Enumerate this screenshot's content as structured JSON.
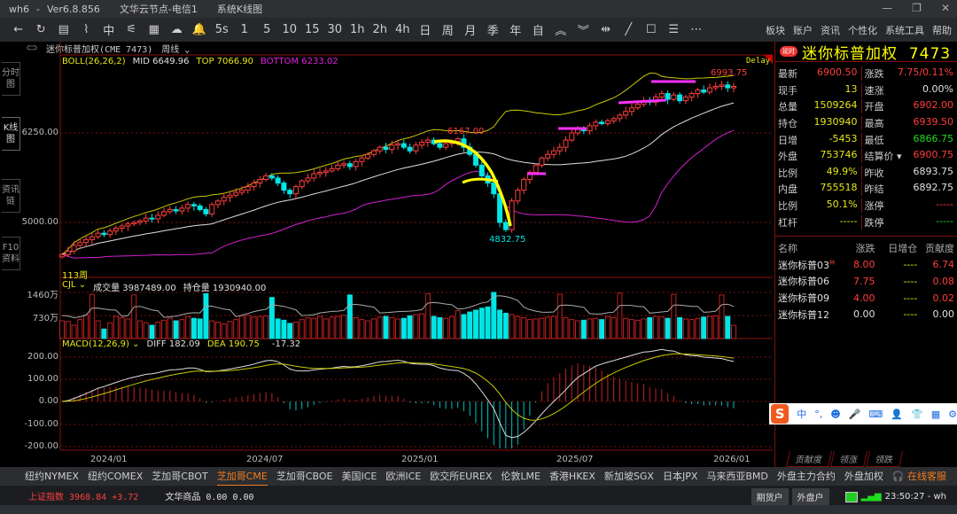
{
  "window": {
    "title_parts": [
      "wh6",
      "-",
      "Ver6.8.856",
      "文华云节点-电信1",
      "系统K线图"
    ],
    "controls": [
      "—",
      "❐",
      "✕"
    ]
  },
  "toolbar": {
    "icons": [
      "←",
      "↻",
      "▤",
      "⌇",
      "中",
      "⚟",
      "▦",
      "☁",
      "🔔"
    ],
    "periods": [
      "5s",
      "1",
      "5",
      "10",
      "15",
      "30",
      "1h",
      "2h",
      "4h",
      "日",
      "周",
      "月",
      "季",
      "年",
      "自"
    ],
    "tools": [
      "︽",
      "︾",
      "⇹",
      "╱",
      "☐",
      "☰",
      "⋯"
    ],
    "menu": [
      "板块",
      "账户",
      "资讯",
      "个性化",
      "系统工具",
      "帮助"
    ]
  },
  "subheader": {
    "symbol": "迷你标普加权(CME 7473)",
    "period": "周线"
  },
  "left_tabs": [
    "分时图",
    "K线图",
    "资讯链",
    "F10资料"
  ],
  "main_indicator": {
    "name": "BOLL(26,26,2)",
    "mid": "MID 6649.96",
    "top": "TOP 7066.90",
    "bottom": "BOTTOM 6233.02",
    "delay": "Delay"
  },
  "volume_indicator": {
    "name": "CJL",
    "vol": "成交量 3987489.00",
    "oi": "持仓量 1930940.00"
  },
  "macd_indicator": {
    "name": "MACD(12,26,9)",
    "diff": "DIFF 182.09",
    "dea": "DEA 190.75",
    "macd": "-17.32"
  },
  "colors": {
    "up": "#ff3d3d",
    "down": "#00e5e5",
    "boll_top": "#c8c800",
    "boll_mid": "#e0e0e0",
    "boll_bot": "#d020d0",
    "grid": "#7a1010",
    "annot_yellow": "#ffff00",
    "annot_magenta": "#ff30ff"
  },
  "chart_data": {
    "type": "candlestick",
    "period": "weekly",
    "price_ticks": [
      "6250.00",
      "5000.00"
    ],
    "price_tick_values": [
      6250,
      5000
    ],
    "volume_ticks": [
      "1460万",
      "730万"
    ],
    "macd_ticks": [
      "200.00",
      "100.00",
      "0.00",
      "-100.00",
      "-200.00"
    ],
    "x_ticks": [
      "2024/01",
      "2024/07",
      "2025/01",
      "2025/07",
      "2026/01"
    ],
    "annotations": {
      "high1": "6167.00",
      "low": "4832.75",
      "high2": "6993.75",
      "bars": "113周"
    },
    "closes": [
      4550,
      4600,
      4680,
      4720,
      4760,
      4800,
      4850,
      4830,
      4880,
      4920,
      4950,
      4980,
      5000,
      5020,
      5060,
      5050,
      5100,
      5150,
      5180,
      5160,
      5200,
      5250,
      5230,
      5180,
      5120,
      5250,
      5300,
      5350,
      5380,
      5420,
      5450,
      5500,
      5550,
      5600,
      5650,
      5620,
      5550,
      5450,
      5400,
      5500,
      5580,
      5620,
      5680,
      5700,
      5720,
      5750,
      5800,
      5820,
      5780,
      5850,
      5900,
      5950,
      6000,
      6050,
      6020,
      6080,
      6100,
      6050,
      6000,
      6080,
      6120,
      6150,
      6100,
      6050,
      6100,
      6130,
      6167,
      6050,
      5950,
      5800,
      5650,
      5550,
      5400,
      5000,
      4900,
      5300,
      5450,
      5600,
      5700,
      5800,
      5900,
      5950,
      6000,
      6050,
      6150,
      6250,
      6300,
      6280,
      6350,
      6400,
      6380,
      6420,
      6450,
      6500,
      6550,
      6600,
      6650,
      6700,
      6680,
      6750,
      6800,
      6720,
      6780,
      6700,
      6750,
      6800,
      6850,
      6820,
      6880,
      6900,
      6920,
      6880,
      6900
    ],
    "volume_wan": [
      560,
      540,
      420,
      600,
      740,
      1400,
      560,
      300,
      500,
      700,
      660,
      620,
      1380,
      560,
      500,
      420,
      520,
      580,
      640,
      560,
      600,
      700,
      640,
      620,
      1420,
      560,
      520,
      460,
      540,
      600,
      720,
      740,
      680,
      700,
      720,
      1300,
      620,
      580,
      480,
      520,
      600,
      660,
      640,
      700,
      620,
      680,
      700,
      740,
      1380,
      660,
      600,
      560,
      620,
      680,
      700,
      660,
      620,
      640,
      720,
      760,
      780,
      1420,
      700,
      660,
      640,
      700,
      880,
      760,
      840,
      900,
      960,
      1000,
      1460,
      900,
      800,
      760,
      700,
      660,
      600,
      620,
      640,
      680,
      700,
      1400,
      660,
      600,
      560,
      580,
      620,
      640,
      600,
      700,
      660,
      1440,
      640,
      600,
      580,
      620,
      660,
      700,
      680,
      640,
      1400,
      660,
      620,
      600,
      640,
      680,
      700,
      720,
      1380,
      700,
      420
    ]
  },
  "quote": {
    "badge": "延时",
    "title": "迷你标普加权  7473",
    "rows": [
      {
        "k1": "最新",
        "v1": "6900.50",
        "c1": "red",
        "k2": "涨跌",
        "v2": "7.75/0.11%",
        "c2": "red"
      },
      {
        "k1": "现手",
        "v1": "13",
        "c1": "yel",
        "k2": "速涨",
        "v2": "0.00%",
        "c2": "wht"
      },
      {
        "k1": "总量",
        "v1": "1509264",
        "c1": "yel",
        "k2": "开盘",
        "v2": "6902.00",
        "c2": "red"
      },
      {
        "k1": "持仓",
        "v1": "1930940",
        "c1": "yel",
        "k2": "最高",
        "v2": "6939.50",
        "c2": "red"
      },
      {
        "k1": "日增",
        "v1": "-5453",
        "c1": "yel",
        "k2": "最低",
        "v2": "6866.75",
        "c2": "grn"
      },
      {
        "k1": "外盘",
        "v1": "753746",
        "c1": "yel",
        "k2": "结算价 ▾",
        "v2": "6900.75",
        "c2": "red"
      },
      {
        "k1": "比例",
        "v1": "49.9%",
        "c1": "yel",
        "k2": "昨收",
        "v2": "6893.75",
        "c2": "wht"
      },
      {
        "k1": "内盘",
        "v1": "755518",
        "c1": "yel",
        "k2": "昨结",
        "v2": "6892.75",
        "c2": "wht"
      },
      {
        "k1": "比例",
        "v1": "50.1%",
        "c1": "yel",
        "k2": "涨停",
        "v2": "-----",
        "c2": "red"
      },
      {
        "k1": "杠杆",
        "v1": "-----",
        "c1": "yel",
        "k2": "跌停",
        "v2": "-----",
        "c2": "grn"
      }
    ],
    "list_header": [
      "名称",
      "涨跌",
      "日增仓",
      "贡献度"
    ],
    "list": [
      {
        "name": "迷你标普03",
        "mark": "M",
        "chg": "8.00",
        "chg_c": "red",
        "oi": "----",
        "contrib": "6.74",
        "ct_c": "red"
      },
      {
        "name": "迷你标普06",
        "mark": "",
        "chg": "7.75",
        "chg_c": "red",
        "oi": "----",
        "contrib": "0.08",
        "ct_c": "red"
      },
      {
        "name": "迷你标普09",
        "mark": "",
        "chg": "4.00",
        "chg_c": "red",
        "oi": "----",
        "contrib": "0.02",
        "ct_c": "red"
      },
      {
        "name": "迷你标普12",
        "mark": "",
        "chg": "0.00",
        "chg_c": "wht",
        "oi": "----",
        "contrib": "0.00",
        "ct_c": "wht"
      }
    ],
    "tabs": [
      "贡献度",
      "领涨",
      "领跌"
    ]
  },
  "exchanges": [
    "纽约NYMEX",
    "纽约COMEX",
    "芝加哥CBOT",
    "芝加哥CME",
    "芝加哥CBOE",
    "美国ICE",
    "欧洲ICE",
    "欧交所EUREX",
    "伦敦LME",
    "香港HKEX",
    "新加坡SGX",
    "日本JPX",
    "马来西亚BMD",
    "外盘主力合约",
    "外盘加权"
  ],
  "active_exchange": 3,
  "service": "在线客服",
  "status": {
    "index_name": "上证指数",
    "index_value": "3968.84",
    "index_chg": "+3.72",
    "wh_name": "文华商品",
    "wh_value": "0.00",
    "wh_chg": "0.00",
    "btn1": "期货户",
    "btn2": "外盘户",
    "clock": "23:50:27 - wh"
  },
  "ime": {
    "logo": "S",
    "items": [
      "中",
      "°,",
      "☻",
      "🎤",
      "⌨",
      "👤",
      "👕",
      "▦",
      "⚙"
    ]
  }
}
